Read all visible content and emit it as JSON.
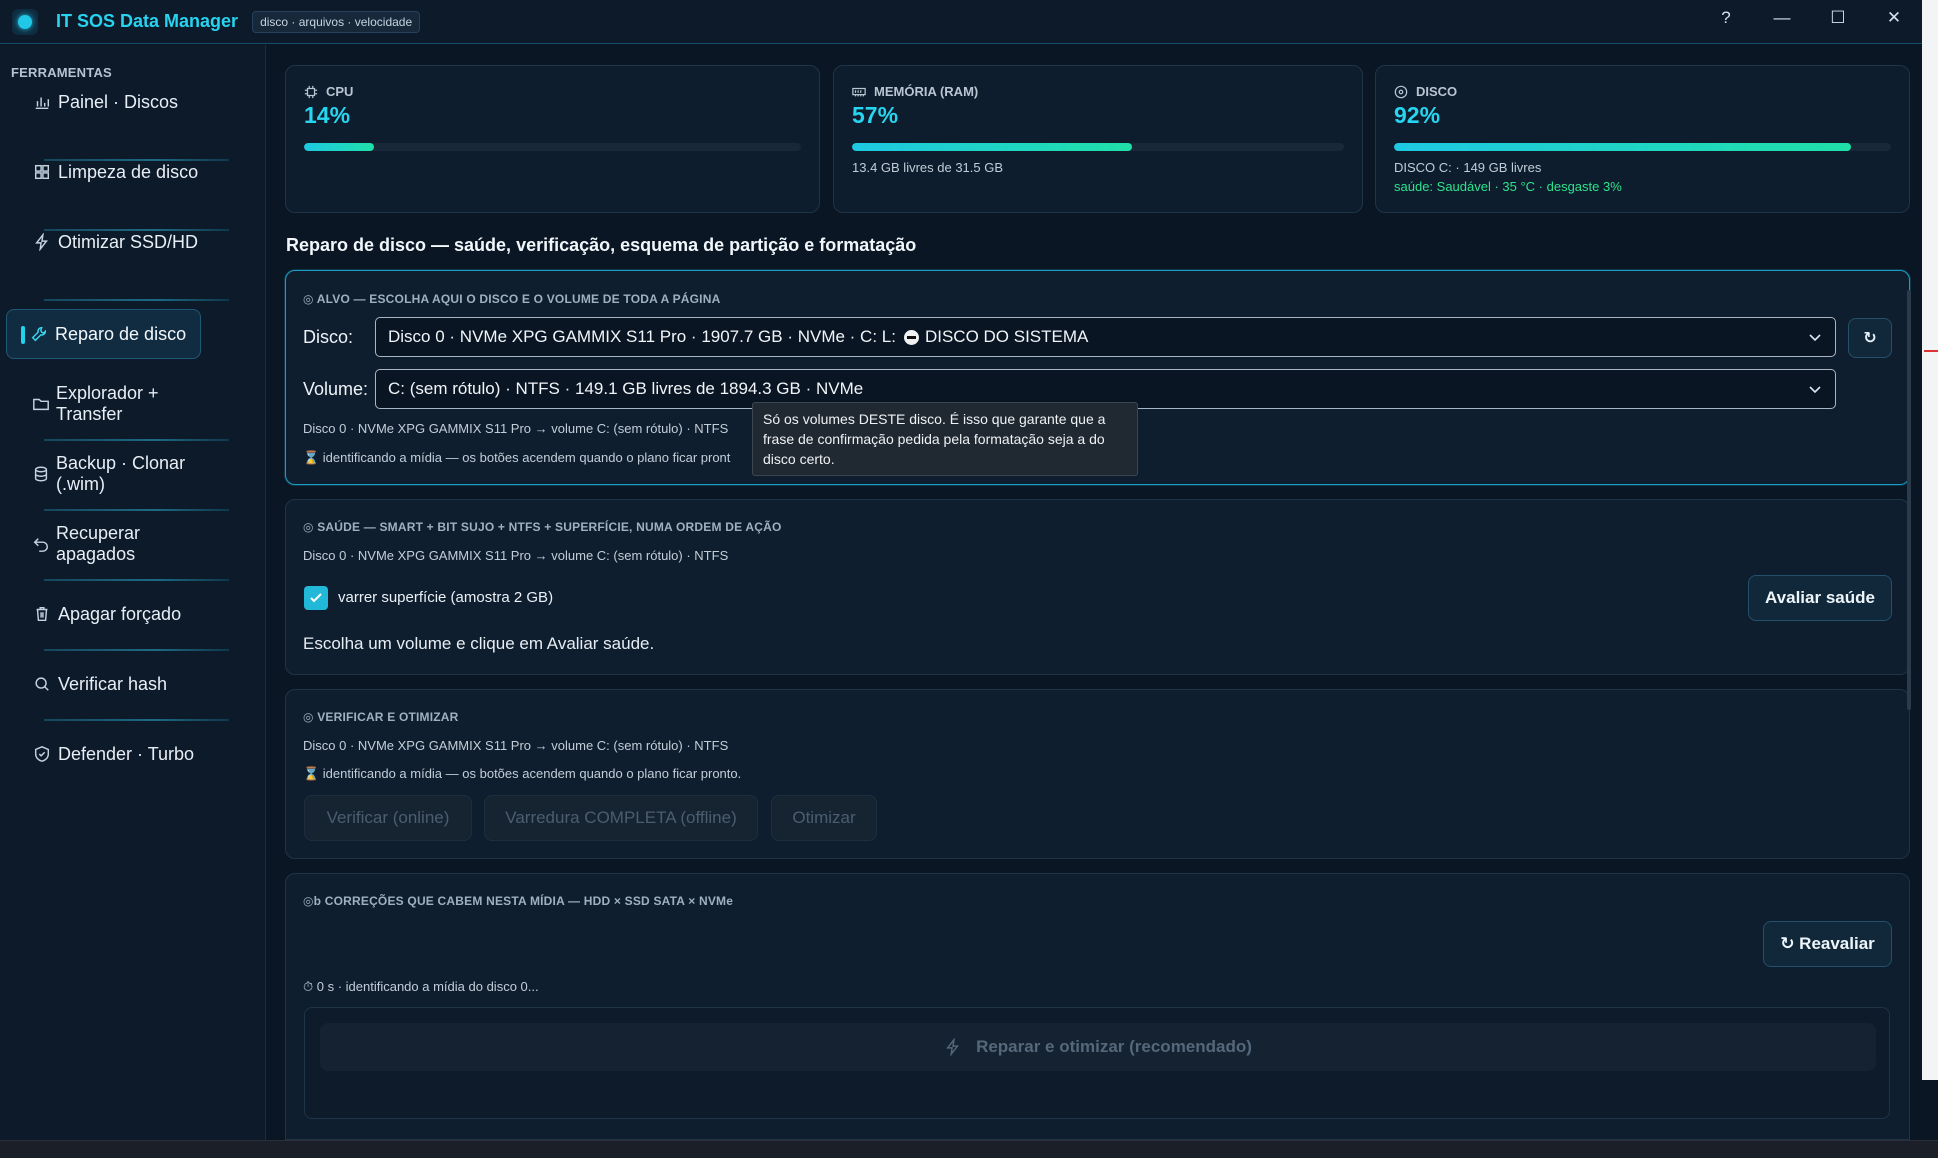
{
  "app": {
    "title": "IT SOS Data Manager",
    "tag": "disco · arquivos · velocidade",
    "controls": [
      "?",
      "—",
      "☐",
      "✕"
    ]
  },
  "sidebar": {
    "heading": "FERRAMENTAS",
    "items": [
      {
        "label": "Painel · Discos",
        "icon": "bar-chart-icon"
      },
      {
        "label": "Limpeza de disco",
        "icon": "grid-icon"
      },
      {
        "label": "Otimizar SSD/HD",
        "icon": "lightning-icon"
      },
      {
        "label": "Reparo de disco",
        "icon": "wrench-icon",
        "active": true
      },
      {
        "label": "Explorador + Transfer",
        "icon": "folder-icon"
      },
      {
        "label": "Backup · Clonar (.wim)",
        "icon": "database-icon"
      },
      {
        "label": "Recuperar apagados",
        "icon": "undo-icon"
      },
      {
        "label": "Apagar forçado",
        "icon": "trash-icon"
      },
      {
        "label": "Verificar hash",
        "icon": "search-icon"
      },
      {
        "label": "Defender · Turbo",
        "icon": "shield-icon"
      }
    ]
  },
  "metrics": {
    "cpu": {
      "label": "CPU",
      "value": "14%",
      "percent": 14
    },
    "ram": {
      "label": "MEMÓRIA (RAM)",
      "value": "57%",
      "percent": 57,
      "sub": "13.4 GB livres de 31.5 GB"
    },
    "disk": {
      "label": "DISCO",
      "value": "92%",
      "percent": 92,
      "sub": "DISCO C: · 149 GB livres",
      "health": "saúde: Saudável · 35 °C · desgaste 3%"
    }
  },
  "section_title": "Reparo de disco — saúde, verificação, esquema de partição e formatação",
  "target": {
    "head": "◎ ALVO — ESCOLHA AQUI O DISCO E O VOLUME DE TODA A PÁGINA",
    "disk_label": "Disco:",
    "disk_value": "Disco 0 · NVMe XPG GAMMIX S11 Pro · 1907.7 GB · NVMe · C: L:",
    "disk_badge": "DISCO DO SISTEMA",
    "volume_label": "Volume:",
    "volume_value": "C: (sem rótulo) · NTFS · 149.1 GB livres de 1894.3 GB · NVMe",
    "summary": "Disco 0 · NVMe XPG GAMMIX S11 Pro  →  volume C: (sem rótulo) · NTFS",
    "status": "⌛ identificando a mídia — os botões acendem quando o plano ficar pront",
    "refresh": "↻",
    "tooltip": "Só os volumes DESTE disco. É isso que garante que a frase de confirmação pedida pela formatação seja a do disco certo."
  },
  "health": {
    "head": "◎ SAÚDE — SMART + BIT SUJO + NTFS + SUPERFÍCIE, NUMA ORDEM DE AÇÃO",
    "summary": "Disco 0 · NVMe XPG GAMMIX S11 Pro  →  volume C: (sem rótulo) · NTFS",
    "checkbox_label": "varrer superfície (amostra 2 GB)",
    "checkbox_checked": true,
    "button": "Avaliar saúde",
    "hint": "Escolha um volume e clique em Avaliar saúde."
  },
  "verify": {
    "head": "◎ VERIFICAR E OTIMIZAR",
    "summary": "Disco 0 · NVMe XPG GAMMIX S11 Pro  →  volume C: (sem rótulo) · NTFS",
    "status": "⌛ identificando a mídia — os botões acendem quando o plano ficar pronto.",
    "buttons": [
      "Verificar (online)",
      "Varredura COMPLETA (offline)",
      "Otimizar"
    ]
  },
  "fixes": {
    "head": "◎b CORREÇÕES QUE CABEM NESTA MÍDIA — HDD × SSD SATA × NVMe",
    "reevaluate": "↻ Reavaliar",
    "status": "⏱ 0 s · identificando a mídia do disco 0...",
    "repair_button": "Reparar e otimizar (recomendado)"
  },
  "colors": {
    "accent": "#22d3ee",
    "health_ok": "#2ee38c",
    "bg": "#0a1624"
  }
}
